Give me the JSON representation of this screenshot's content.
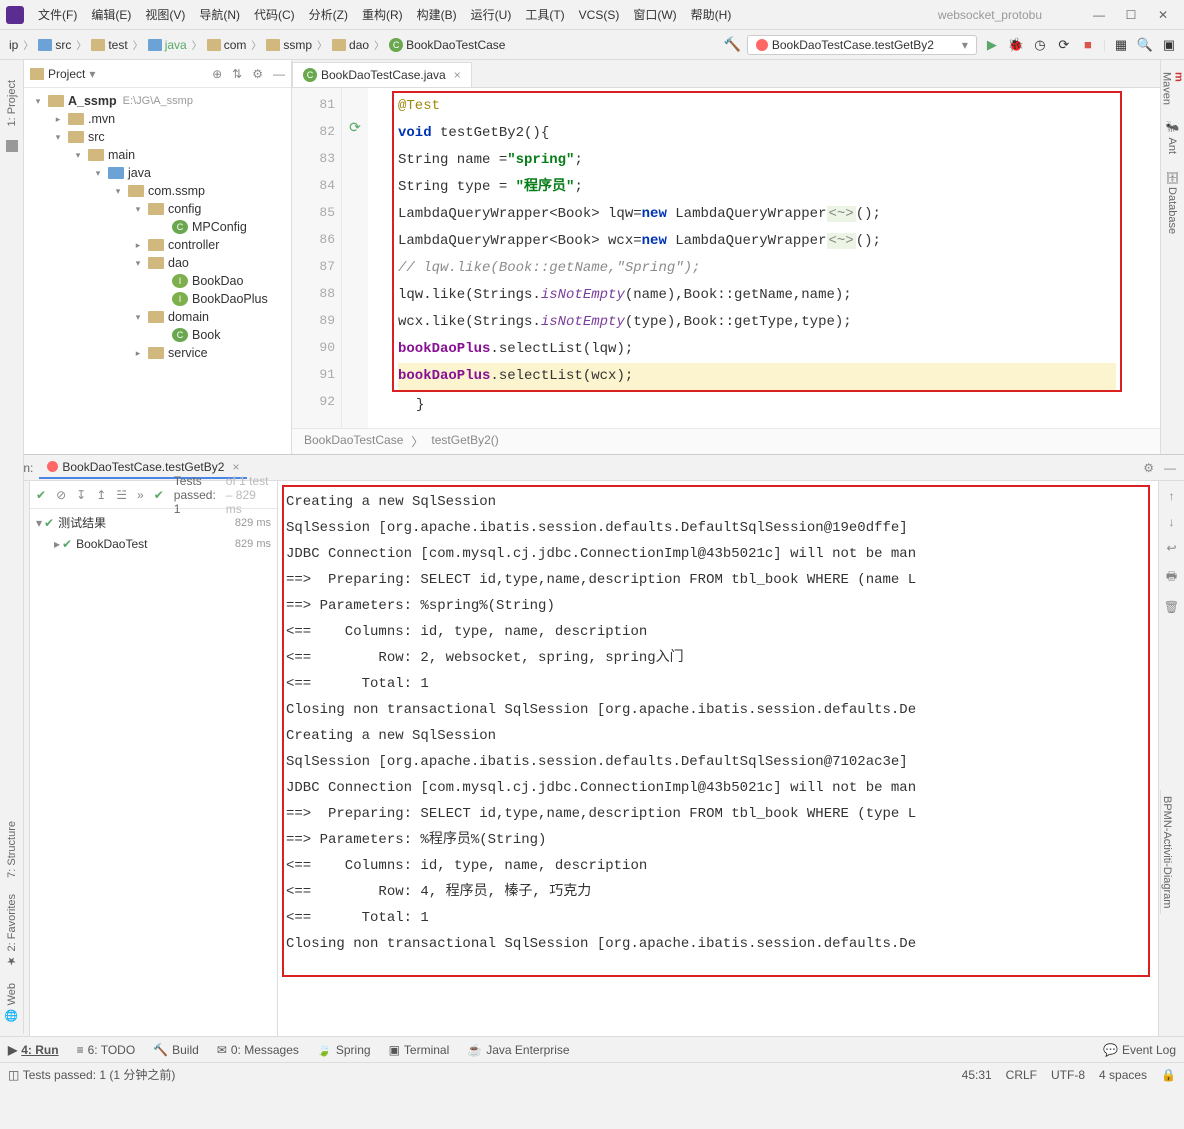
{
  "menus": [
    "文件(F)",
    "编辑(E)",
    "视图(V)",
    "导航(N)",
    "代码(C)",
    "分析(Z)",
    "重构(R)",
    "构建(B)",
    "运行(U)",
    "工具(T)",
    "VCS(S)",
    "窗口(W)",
    "帮助(H)"
  ],
  "project_hint": "websocket_protobu",
  "breadcrumbs": [
    "ip",
    "src",
    "test",
    "java",
    "com",
    "ssmp",
    "dao",
    "BookDaoTestCase"
  ],
  "run_config": "BookDaoTestCase.testGetBy2",
  "project_view": "Project",
  "tree": {
    "root": "A_ssmp",
    "root_path": "E:\\JG\\A_ssmp",
    "mvn": ".mvn",
    "src": "src",
    "main": "main",
    "java": "java",
    "pkg": "com.ssmp",
    "config": "config",
    "mpconfig": "MPConfig",
    "controller": "controller",
    "dao": "dao",
    "bookdao": "BookDao",
    "bookdaoplus": "BookDaoPlus",
    "domain": "domain",
    "book": "Book",
    "service": "service"
  },
  "tab_file": "BookDaoTestCase.java",
  "line_numbers": [
    "81",
    "82",
    "83",
    "84",
    "85",
    "86",
    "87",
    "88",
    "89",
    "90",
    "91",
    "92"
  ],
  "code": {
    "l1_ann": "@Test",
    "l2_kw": "void",
    "l2_rest": " testGetBy2(){",
    "l3_a": "    String name =",
    "l3_str": "\"spring\"",
    "l3_b": ";",
    "l4_a": "    String type = ",
    "l4_str": "\"程序员\"",
    "l4_b": ";",
    "l5_a": "    LambdaQueryWrapper<Book> lqw=",
    "l5_kw": "new",
    "l5_b": " LambdaQueryWrapper",
    "l5_h": "<~>",
    "l5_c": "();",
    "l6_a": "    LambdaQueryWrapper<Book> wcx=",
    "l6_kw": "new",
    "l6_b": " LambdaQueryWrapper",
    "l6_h": "<~>",
    "l6_c": "();",
    "l7": "      lqw.like(Book::getName,\"Spring\");",
    "l8_a": "    lqw.like(Strings.",
    "l8_m": "isNotEmpty",
    "l8_b": "(name),Book::getName,name);",
    "l9_a": "    wcx.like(Strings.",
    "l9_m": "isNotEmpty",
    "l9_b": "(type),Book::getType,type);",
    "l10_a": "    ",
    "l10_f": "bookDaoPlus",
    "l10_b": ".selectList(lqw);",
    "l11_a": "    ",
    "l11_f": "bookDaoPlus",
    "l11_b": ".selectList(wcx);",
    "l12": "}"
  },
  "editor_crumb": {
    "a": "BookDaoTestCase",
    "b": "testGetBy2()"
  },
  "right_tools": [
    "Maven",
    "Ant",
    "Database",
    "BPMN-Activiti-Diagram"
  ],
  "left_tools": {
    "project": "1: Project",
    "structure": "7: Structure",
    "favorites": "2: Favorites",
    "web": "Web"
  },
  "run": {
    "label": "Run:",
    "tab": "BookDaoTestCase.testGetBy2",
    "pass_text": "Tests passed: 1",
    "pass_suffix": " of 1 test – 829 ms",
    "root_node": "测试结果",
    "root_time": "829 ms",
    "child_node": "BookDaoTest",
    "child_time": "829 ms"
  },
  "console": [
    "Creating a new SqlSession",
    "SqlSession [org.apache.ibatis.session.defaults.DefaultSqlSession@19e0dffe]",
    "JDBC Connection [com.mysql.cj.jdbc.ConnectionImpl@43b5021c] will not be man",
    "==>  Preparing: SELECT id,type,name,description FROM tbl_book WHERE (name L",
    "==> Parameters: %spring%(String)",
    "<==    Columns: id, type, name, description",
    "<==        Row: 2, websocket, spring, spring入门",
    "<==      Total: 1",
    "Closing non transactional SqlSession [org.apache.ibatis.session.defaults.De",
    "Creating a new SqlSession",
    "SqlSession [org.apache.ibatis.session.defaults.DefaultSqlSession@7102ac3e]",
    "JDBC Connection [com.mysql.cj.jdbc.ConnectionImpl@43b5021c] will not be man",
    "==>  Preparing: SELECT id,type,name,description FROM tbl_book WHERE (type L",
    "==> Parameters: %程序员%(String)",
    "<==    Columns: id, type, name, description",
    "<==        Row: 4, 程序员, 榛子, 巧克力",
    "<==      Total: 1",
    "Closing non transactional SqlSession [org.apache.ibatis.session.defaults.De"
  ],
  "bottom_tabs": {
    "run": "4: Run",
    "todo": "6: TODO",
    "build": "Build",
    "messages": "0: Messages",
    "spring": "Spring",
    "terminal": "Terminal",
    "jee": "Java Enterprise",
    "event": "Event Log"
  },
  "status": {
    "msg": "Tests passed: 1 (1 分钟之前)",
    "pos": "45:31",
    "eol": "CRLF",
    "enc": "UTF-8",
    "ind": "4 spaces"
  }
}
